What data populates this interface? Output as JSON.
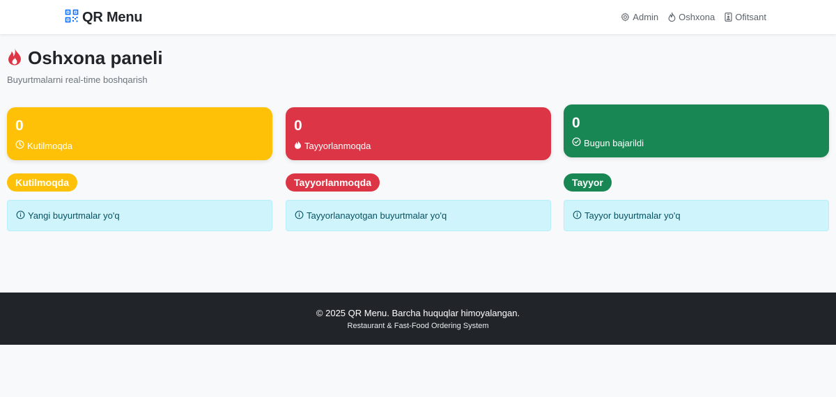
{
  "navbar": {
    "brand": "QR Menu",
    "brand_icon": "qr-code-icon",
    "links": [
      {
        "label": "Admin",
        "icon": "gear-icon"
      },
      {
        "label": "Oshxona",
        "icon": "fire-icon"
      },
      {
        "label": "Ofitsant",
        "icon": "person-badge-icon"
      }
    ]
  },
  "page": {
    "title": "Oshxona paneli",
    "title_icon": "fire-icon",
    "subtitle": "Buyurtmalarni real-time boshqarish"
  },
  "stats": [
    {
      "count": "0",
      "label": "Kutilmoqda",
      "icon": "clock-icon",
      "color": "#ffc107"
    },
    {
      "count": "0",
      "label": "Tayyorlanmoqda",
      "icon": "fire-icon",
      "color": "#dc3545"
    },
    {
      "count": "0",
      "label": "Bugun bajarildi",
      "icon": "check-circle-icon",
      "color": "#198754"
    }
  ],
  "columns": [
    {
      "title": "Kutilmoqda",
      "color": "#ffc107",
      "empty_message": "Yangi buyurtmalar yo'q"
    },
    {
      "title": "Tayyorlanmoqda",
      "color": "#dc3545",
      "empty_message": "Tayyorlanayotgan buyurtmalar yo'q"
    },
    {
      "title": "Tayyor",
      "color": "#198754",
      "empty_message": "Tayyor buyurtmalar yo'q"
    }
  ],
  "footer": {
    "copyright": "© 2025 QR Menu. Barcha huquqlar himoyalangan.",
    "tagline": "Restaurant & Fast-Food Ordering System"
  }
}
